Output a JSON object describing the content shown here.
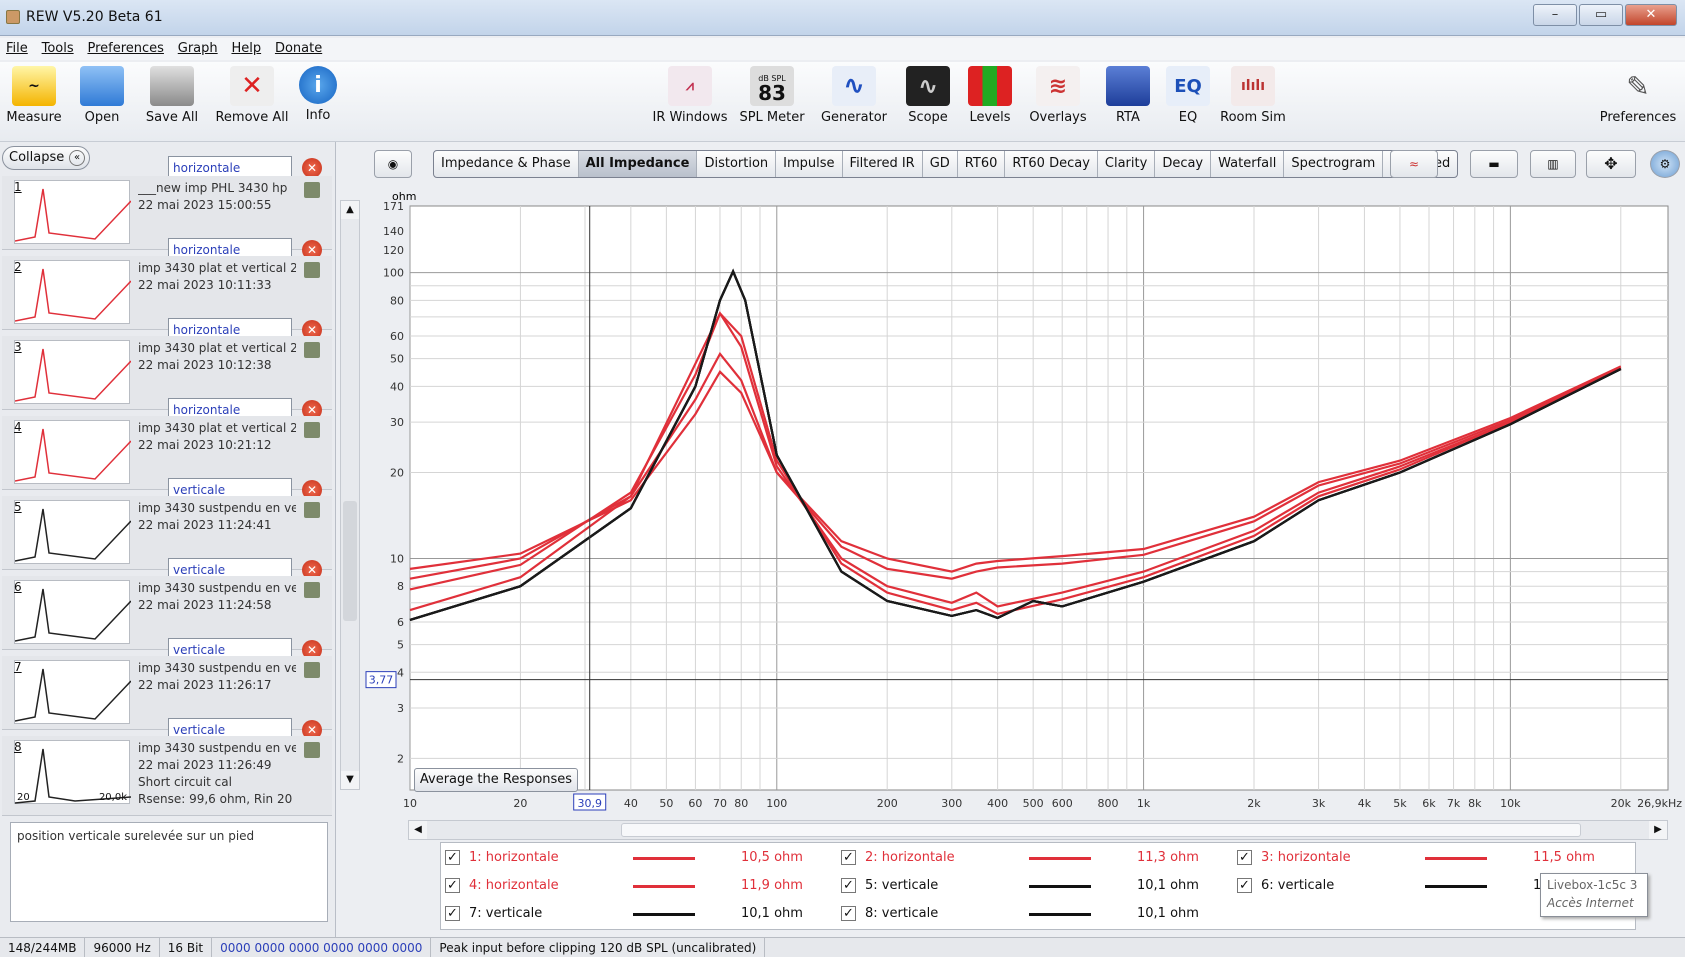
{
  "window": {
    "title": "REW V5.20 Beta 61",
    "min": "–",
    "max": "▭",
    "close": "✕"
  },
  "menu": [
    "File",
    "Tools",
    "Preferences",
    "Graph",
    "Help",
    "Donate"
  ],
  "toolbar_left": [
    {
      "label": "Measure",
      "icon": "measure-icon"
    },
    {
      "label": "Open",
      "icon": "folder-icon"
    },
    {
      "label": "Save All",
      "icon": "save-icon"
    },
    {
      "label": "Remove All",
      "icon": "remove-icon"
    },
    {
      "label": "Info",
      "icon": "info-icon"
    }
  ],
  "toolbar_center": [
    {
      "label": "IR Windows",
      "icon": "ir-windows-icon"
    },
    {
      "label": "SPL Meter",
      "icon": "spl-meter-icon",
      "top": "dB SPL",
      "value": "83"
    },
    {
      "label": "Generator",
      "icon": "generator-icon"
    },
    {
      "label": "Scope",
      "icon": "scope-icon"
    },
    {
      "label": "Levels",
      "icon": "levels-icon"
    },
    {
      "label": "Overlays",
      "icon": "overlays-icon"
    },
    {
      "label": "RTA",
      "icon": "rta-icon"
    },
    {
      "label": "EQ",
      "icon": "eq-icon"
    },
    {
      "label": "Room Sim",
      "icon": "room-sim-icon"
    }
  ],
  "toolbar_right": {
    "label": "Preferences",
    "icon": "wrench-icon"
  },
  "graph_tabs": [
    "Impedance & Phase",
    "All Impedance",
    "Distortion",
    "Impulse",
    "Filtered IR",
    "GD",
    "RT60",
    "RT60 Decay",
    "Clarity",
    "Decay",
    "Waterfall",
    "Spectrogram",
    "Captured"
  ],
  "active_tab": "All Impedance",
  "panel": {
    "collapse": "Collapse",
    "top_name": "horizontale",
    "notes": "position verticale surelevée sur un pied",
    "measurements": [
      {
        "num": "1",
        "title": "___new imp PHL 3430 hp",
        "date": "22 mai 2023 15:00:55",
        "name": "horizontale",
        "color": "#e0303a"
      },
      {
        "num": "2",
        "title": "imp 3430 plat et vertical 2",
        "date": "22 mai 2023 10:11:33",
        "name": "horizontale",
        "color": "#e0303a"
      },
      {
        "num": "3",
        "title": "imp 3430 plat et vertical 2",
        "date": "22 mai 2023 10:12:38",
        "name": "horizontale",
        "color": "#e0303a"
      },
      {
        "num": "4",
        "title": "imp 3430 plat et vertical 2",
        "date": "22 mai 2023 10:21:12",
        "name": "verticale",
        "color": "#e0303a"
      },
      {
        "num": "5",
        "title": "imp 3430 sustpendu en ve",
        "date": "22 mai 2023 11:24:41",
        "name": "verticale",
        "color": "#222222"
      },
      {
        "num": "6",
        "title": "imp 3430 sustpendu en ve",
        "date": "22 mai 2023 11:24:58",
        "name": "verticale",
        "color": "#222222"
      },
      {
        "num": "7",
        "title": "imp 3430 sustpendu en ve",
        "date": "22 mai 2023 11:26:17",
        "name": "verticale",
        "color": "#222222"
      }
    ],
    "last": {
      "num": "8",
      "title": "imp 3430 sustpendu en ve",
      "date": "22 mai 2023 11:26:49",
      "line3": "Short circuit cal",
      "line4": "Rsense: 99,6 ohm, Rin 20",
      "thumb_left": "20",
      "thumb_right": "20,0k"
    }
  },
  "chart_data": {
    "type": "line",
    "x_scale": "log",
    "y_scale": "log",
    "ylabel": "ohm",
    "xlim": [
      10,
      26900
    ],
    "ylim": [
      1.55,
      171
    ],
    "y_ticks": [
      "171",
      "140",
      "120",
      "100",
      "80",
      "60",
      "50",
      "40",
      "30",
      "20",
      "10",
      "8",
      "6",
      "5",
      "4",
      "3",
      "2"
    ],
    "x_ticks": [
      "10",
      "20",
      "30,9",
      "40",
      "50",
      "60",
      "70",
      "80",
      "100",
      "200",
      "300",
      "400",
      "500",
      "600",
      "800",
      "1k",
      "2k",
      "3k",
      "4k",
      "5k",
      "6k",
      "7k",
      "8k",
      "10k",
      "20k",
      "26,9kHz"
    ],
    "cursor": {
      "x": "30,9",
      "y": "3,77"
    },
    "series": [
      {
        "name": "horizontale",
        "color": "#e0303a",
        "points": [
          [
            10,
            9.2
          ],
          [
            20,
            10.4
          ],
          [
            40,
            16
          ],
          [
            60,
            32
          ],
          [
            70,
            45
          ],
          [
            80,
            38
          ],
          [
            100,
            20
          ],
          [
            150,
            11.5
          ],
          [
            200,
            10
          ],
          [
            300,
            9
          ],
          [
            350,
            9.6
          ],
          [
            400,
            9.8
          ],
          [
            600,
            10.2
          ],
          [
            1000,
            10.8
          ],
          [
            2000,
            14
          ],
          [
            3000,
            18.5
          ],
          [
            5000,
            22
          ],
          [
            10000,
            31
          ],
          [
            20000,
            47
          ]
        ]
      },
      {
        "name": "horizontale",
        "color": "#e0303a",
        "points": [
          [
            10,
            8.5
          ],
          [
            20,
            10
          ],
          [
            40,
            16.5
          ],
          [
            60,
            36
          ],
          [
            70,
            52
          ],
          [
            80,
            42
          ],
          [
            100,
            20
          ],
          [
            150,
            11
          ],
          [
            200,
            9.2
          ],
          [
            300,
            8.5
          ],
          [
            350,
            9
          ],
          [
            400,
            9.3
          ],
          [
            600,
            9.6
          ],
          [
            1000,
            10.3
          ],
          [
            2000,
            13.5
          ],
          [
            3000,
            18
          ],
          [
            5000,
            21.5
          ],
          [
            10000,
            30.5
          ],
          [
            20000,
            46.5
          ]
        ]
      },
      {
        "name": "horizontale",
        "color": "#e0303a",
        "points": [
          [
            10,
            7.8
          ],
          [
            20,
            9.5
          ],
          [
            40,
            17
          ],
          [
            60,
            44
          ],
          [
            70,
            72
          ],
          [
            80,
            55
          ],
          [
            100,
            21
          ],
          [
            150,
            10
          ],
          [
            200,
            8
          ],
          [
            300,
            7
          ],
          [
            350,
            7.6
          ],
          [
            400,
            6.8
          ],
          [
            600,
            7.6
          ],
          [
            1000,
            9
          ],
          [
            2000,
            12.5
          ],
          [
            3000,
            17
          ],
          [
            5000,
            21
          ],
          [
            10000,
            30
          ],
          [
            20000,
            46
          ]
        ]
      },
      {
        "name": "horizontale",
        "color": "#e0303a",
        "points": [
          [
            10,
            6.6
          ],
          [
            20,
            8.6
          ],
          [
            40,
            16.5
          ],
          [
            60,
            48
          ],
          [
            70,
            72
          ],
          [
            80,
            60
          ],
          [
            100,
            22
          ],
          [
            150,
            9.6
          ],
          [
            200,
            7.6
          ],
          [
            300,
            6.6
          ],
          [
            350,
            7
          ],
          [
            400,
            6.4
          ],
          [
            600,
            7.2
          ],
          [
            1000,
            8.6
          ],
          [
            2000,
            12
          ],
          [
            3000,
            16.5
          ],
          [
            5000,
            20.5
          ],
          [
            10000,
            30
          ],
          [
            20000,
            46
          ]
        ]
      },
      {
        "name": "verticale",
        "color": "#1a1a1a",
        "points": [
          [
            10,
            6.1
          ],
          [
            20,
            8
          ],
          [
            40,
            15
          ],
          [
            60,
            40
          ],
          [
            70,
            80
          ],
          [
            76,
            101
          ],
          [
            82,
            80
          ],
          [
            100,
            23
          ],
          [
            150,
            9
          ],
          [
            200,
            7.1
          ],
          [
            300,
            6.3
          ],
          [
            350,
            6.6
          ],
          [
            400,
            6.2
          ],
          [
            500,
            7.1
          ],
          [
            600,
            6.8
          ],
          [
            1000,
            8.3
          ],
          [
            2000,
            11.5
          ],
          [
            3000,
            16
          ],
          [
            5000,
            20
          ],
          [
            10000,
            29.5
          ],
          [
            20000,
            46
          ]
        ]
      },
      {
        "name": "verticale",
        "color": "#1a1a1a",
        "points": [
          [
            10,
            6.1
          ],
          [
            20,
            8
          ],
          [
            40,
            15
          ],
          [
            60,
            40
          ],
          [
            70,
            80
          ],
          [
            76,
            101
          ],
          [
            82,
            80
          ],
          [
            100,
            23
          ],
          [
            150,
            9
          ],
          [
            200,
            7.1
          ],
          [
            300,
            6.3
          ],
          [
            350,
            6.6
          ],
          [
            400,
            6.2
          ],
          [
            500,
            7.1
          ],
          [
            600,
            6.8
          ],
          [
            1000,
            8.3
          ],
          [
            2000,
            11.5
          ],
          [
            3000,
            16
          ],
          [
            5000,
            20
          ],
          [
            10000,
            29.5
          ],
          [
            20000,
            46
          ]
        ]
      },
      {
        "name": "verticale",
        "color": "#1a1a1a",
        "points": [
          [
            10,
            6.1
          ],
          [
            20,
            8
          ],
          [
            40,
            15
          ],
          [
            60,
            40
          ],
          [
            70,
            80
          ],
          [
            76,
            101
          ],
          [
            82,
            80
          ],
          [
            100,
            23
          ],
          [
            150,
            9
          ],
          [
            200,
            7.1
          ],
          [
            300,
            6.3
          ],
          [
            350,
            6.6
          ],
          [
            400,
            6.2
          ],
          [
            500,
            7.1
          ],
          [
            600,
            6.8
          ],
          [
            1000,
            8.3
          ],
          [
            2000,
            11.5
          ],
          [
            3000,
            16
          ],
          [
            5000,
            20
          ],
          [
            10000,
            29.5
          ],
          [
            20000,
            46
          ]
        ]
      },
      {
        "name": "verticale",
        "color": "#1a1a1a",
        "points": [
          [
            10,
            6.1
          ],
          [
            20,
            8
          ],
          [
            40,
            15
          ],
          [
            60,
            40
          ],
          [
            70,
            80
          ],
          [
            76,
            101
          ],
          [
            82,
            80
          ],
          [
            100,
            23
          ],
          [
            150,
            9
          ],
          [
            200,
            7.1
          ],
          [
            300,
            6.3
          ],
          [
            350,
            6.6
          ],
          [
            400,
            6.2
          ],
          [
            500,
            7.1
          ],
          [
            600,
            6.8
          ],
          [
            1000,
            8.3
          ],
          [
            2000,
            11.5
          ],
          [
            3000,
            16
          ],
          [
            5000,
            20
          ],
          [
            10000,
            29.5
          ],
          [
            20000,
            46
          ]
        ]
      }
    ]
  },
  "average_button": "Average the Responses",
  "legend": [
    {
      "label": "1: horizontale",
      "value": "10,5 ohm",
      "color": "#e0303a"
    },
    {
      "label": "2: horizontale",
      "value": "11,3 ohm",
      "color": "#e0303a"
    },
    {
      "label": "3: horizontale",
      "value": "11,5 ohm",
      "color": "#e0303a"
    },
    {
      "label": "4: horizontale",
      "value": "11,9 ohm",
      "color": "#e0303a"
    },
    {
      "label": "5: verticale",
      "value": "10,1 ohm",
      "color": "#111111"
    },
    {
      "label": "6: verticale",
      "value": "10",
      "color": "#111111"
    },
    {
      "label": "7: verticale",
      "value": "10,1 ohm",
      "color": "#111111"
    },
    {
      "label": "8: verticale",
      "value": "10,1 ohm",
      "color": "#111111"
    }
  ],
  "tooltip": {
    "line1": "Livebox-1c5c 3",
    "line2": "Accès Internet"
  },
  "status": {
    "mem": "148/244MB",
    "rate": "96000 Hz",
    "bits": "16 Bit",
    "input": "0000 0000  0000 0000  0000 0000",
    "message": "Peak input before clipping 120 dB SPL (uncalibrated)"
  }
}
